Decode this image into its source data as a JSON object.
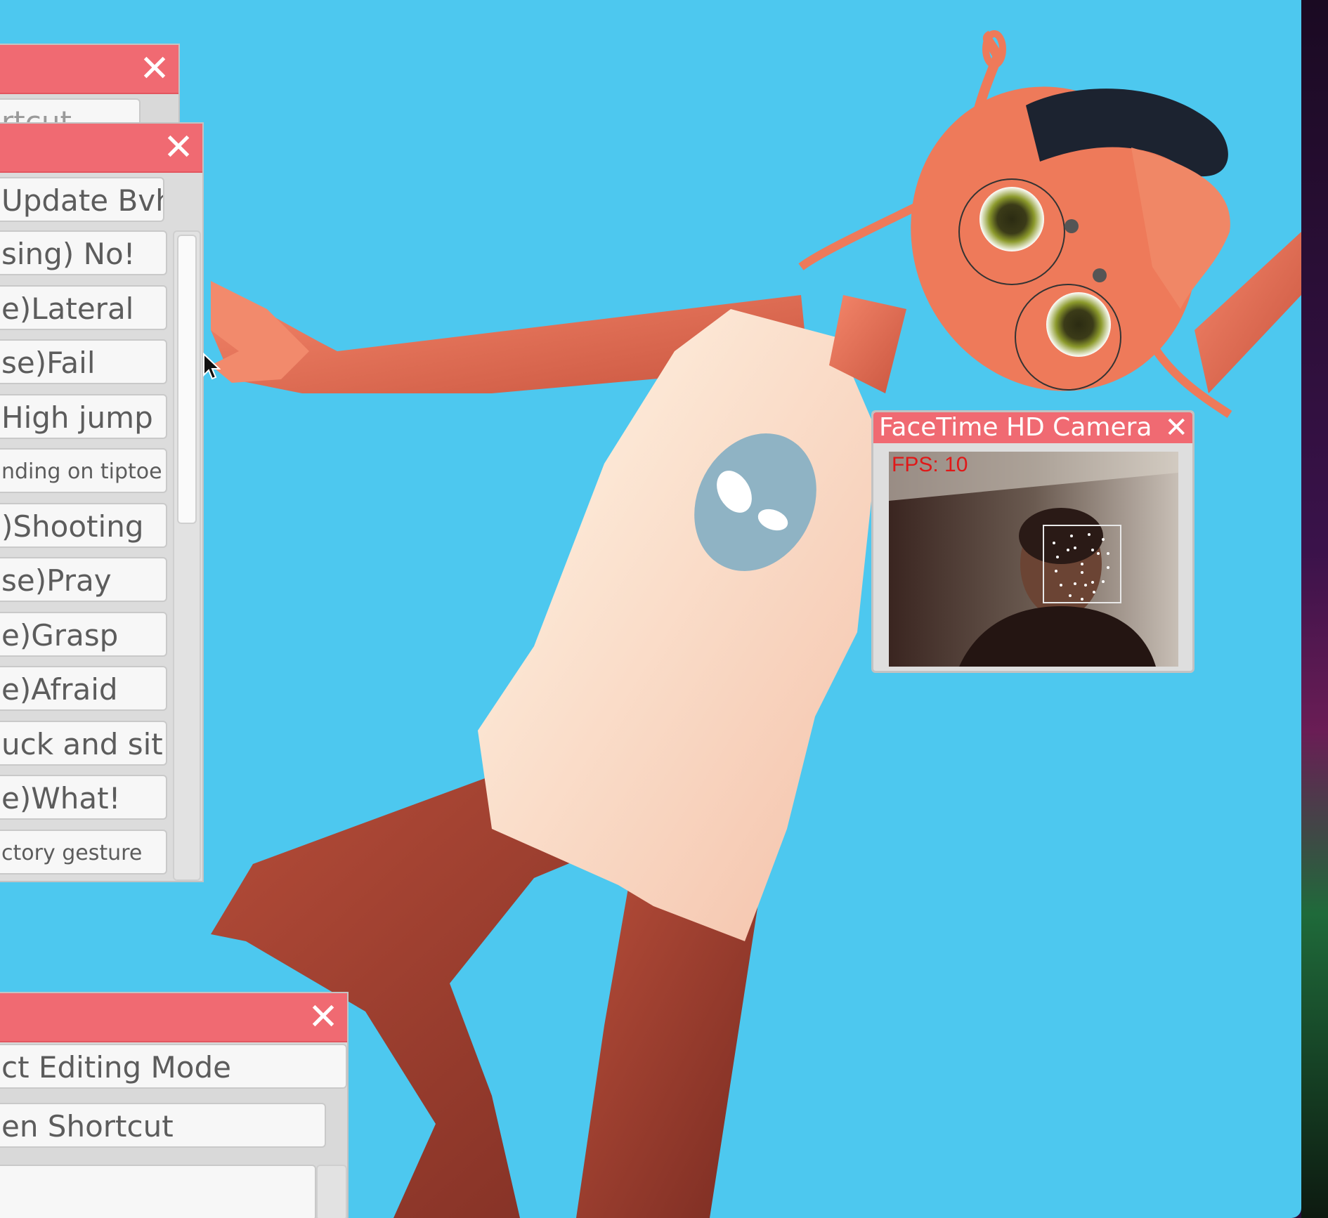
{
  "panel_top": {
    "button_partial": "rtcut"
  },
  "panel_bvh": {
    "update_button": "Update Bvh",
    "items": [
      {
        "label": "sing) No!",
        "small": false
      },
      {
        "label": "e)Lateral",
        "small": false
      },
      {
        "label": "se)Fail",
        "small": false
      },
      {
        "label": "High jump",
        "small": false
      },
      {
        "label": "nding on tiptoe",
        "small": true
      },
      {
        "label": ")Shooting",
        "small": false
      },
      {
        "label": "se)Pray",
        "small": false
      },
      {
        "label": "e)Grasp",
        "small": false
      },
      {
        "label": "e)Afraid",
        "small": false
      },
      {
        "label": "uck and sit",
        "small": false
      },
      {
        "label": "e)What!",
        "small": false
      },
      {
        "label": "ctory gesture",
        "small": true
      }
    ]
  },
  "panel_bottom": {
    "editing_mode_button": "ct Editing Mode",
    "shortcut_button": "en Shortcut"
  },
  "camera": {
    "title": "FaceTime HD Camera",
    "fps": "FPS: 10"
  },
  "icons": {
    "close": "close-icon",
    "cursor": "mouse-cursor-icon"
  },
  "colors": {
    "background": "#4dc8ef",
    "titlebar": "#f06a72",
    "button": "#f7f7f7",
    "fps_text": "#e01818"
  }
}
